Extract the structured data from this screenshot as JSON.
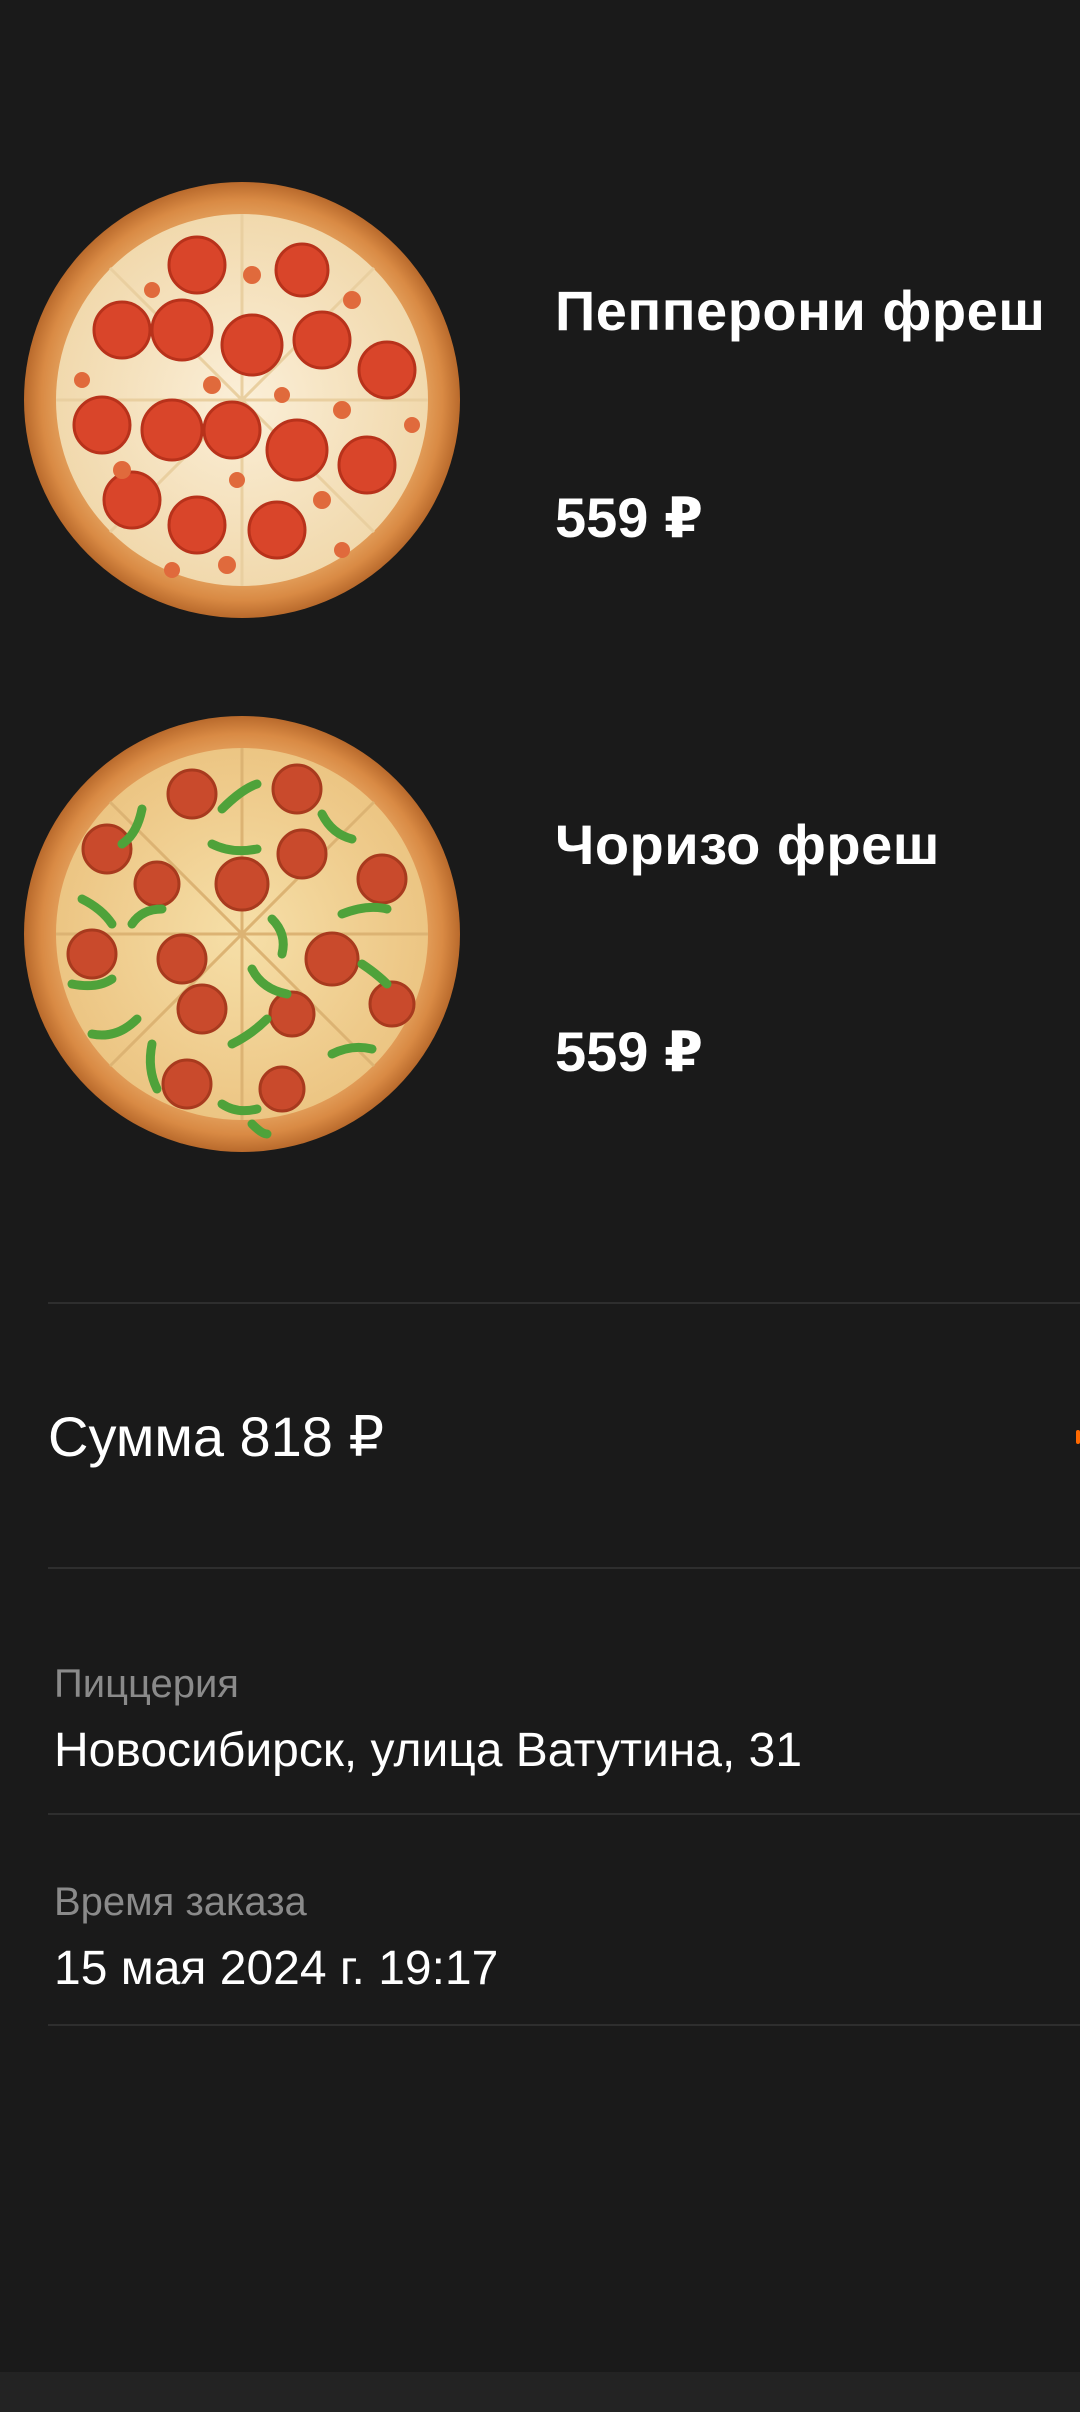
{
  "order_items": [
    {
      "name": "Пепперони фреш",
      "price": "559 ₽",
      "image": "pepperoni-pizza"
    },
    {
      "name": "Чоризо фреш",
      "price": "559 ₽",
      "image": "chorizo-pizza"
    }
  ],
  "summary": {
    "total": "Сумма 818 ₽"
  },
  "details": {
    "pizzeria_label": "Пиццерия",
    "pizzeria_value": "Новосибирск, улица Ватутина, 31",
    "time_label": "Время заказа",
    "time_value": "15 мая 2024 г. 19:17"
  },
  "colors": {
    "background": "#1a1a1a",
    "accent": "#ff6900",
    "muted_text": "#8a8a8a",
    "divider": "#2e2e2e"
  }
}
